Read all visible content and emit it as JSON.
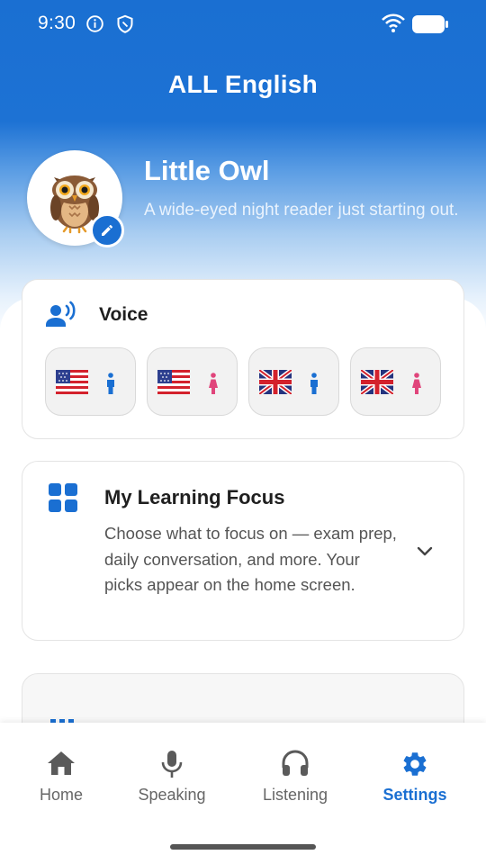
{
  "status_bar": {
    "time": "9:30",
    "icons": [
      "info-icon",
      "shield-icon",
      "wifi-icon",
      "battery-icon"
    ]
  },
  "app": {
    "title": "ALL English",
    "accent_color": "#1a6fd2"
  },
  "profile": {
    "avatar": "owl-avatar",
    "name": "Little Owl",
    "description": "A wide-eyed night reader just starting out."
  },
  "voice": {
    "title": "Voice",
    "icon": "record-voice-icon",
    "options": [
      {
        "flag": "us-flag-icon",
        "gender": "male-icon",
        "gender_color": "#1a6fd2"
      },
      {
        "flag": "us-flag-icon",
        "gender": "female-icon",
        "gender_color": "#e0457b"
      },
      {
        "flag": "uk-flag-icon",
        "gender": "male-icon",
        "gender_color": "#1a6fd2"
      },
      {
        "flag": "uk-flag-icon",
        "gender": "female-icon",
        "gender_color": "#e0457b"
      }
    ]
  },
  "learning_focus": {
    "title": "My Learning Focus",
    "description": "Choose what to focus on — exam prep, daily conversation, and more. Your picks appear on the home screen.",
    "icon": "dashboard-grid-icon",
    "expand_icon": "chevron-down-icon"
  },
  "next_section": {
    "icon": "bars-icon"
  },
  "bottom_nav": {
    "items": [
      {
        "label": "Home",
        "icon": "home-icon",
        "active": false
      },
      {
        "label": "Speaking",
        "icon": "microphone-icon",
        "active": false
      },
      {
        "label": "Listening",
        "icon": "headphones-icon",
        "active": false
      },
      {
        "label": "Settings",
        "icon": "gear-icon",
        "active": true
      }
    ]
  }
}
